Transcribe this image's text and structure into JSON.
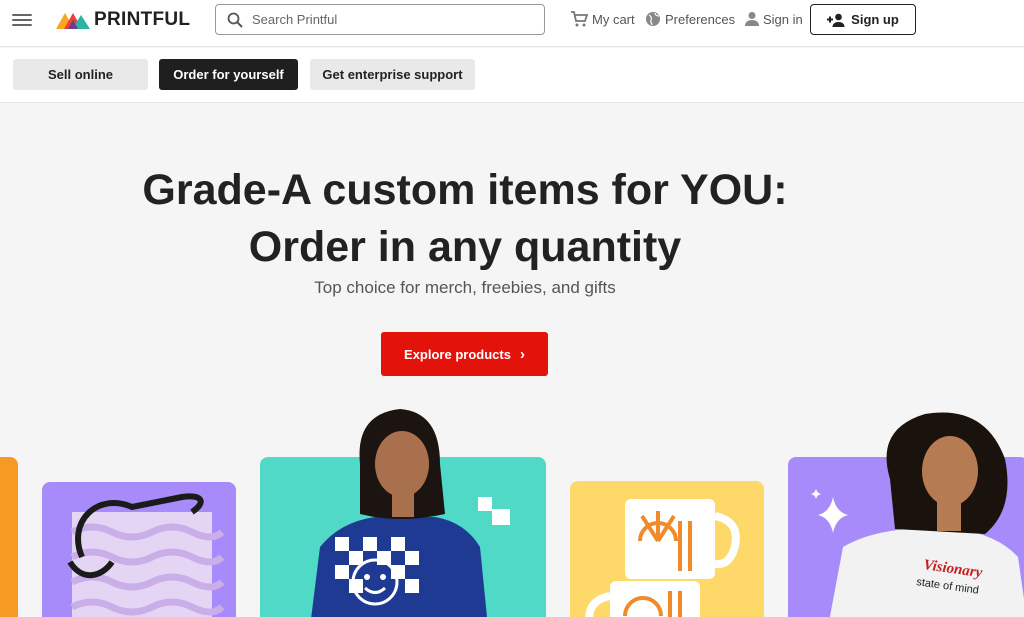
{
  "header": {
    "logo_text": "PRINTFUL",
    "search_placeholder": "Search Printful",
    "cart_label": "My cart",
    "preferences_label": "Preferences",
    "signin_label": "Sign in",
    "signup_label": "Sign up"
  },
  "tabs": [
    {
      "label": "Sell online",
      "active": false
    },
    {
      "label": "Order for yourself",
      "active": true
    },
    {
      "label": "Get enterprise support",
      "active": false
    }
  ],
  "hero": {
    "headline_line1": "Grade-A custom items for YOU:",
    "headline_line2": "Order in any quantity",
    "subtitle": "Top choice for merch, freebies, and gifts",
    "cta_label": "Explore products",
    "shirt_text_1": "Visionary",
    "shirt_text_2": "state of mind"
  },
  "colors": {
    "cta": "#e3120b",
    "active_tab": "#1f1f1f",
    "tile_purple": "#a78bfa",
    "tile_teal": "#4fd9c6",
    "tile_yellow": "#ffd86a",
    "tile_orange": "#f59a23"
  }
}
